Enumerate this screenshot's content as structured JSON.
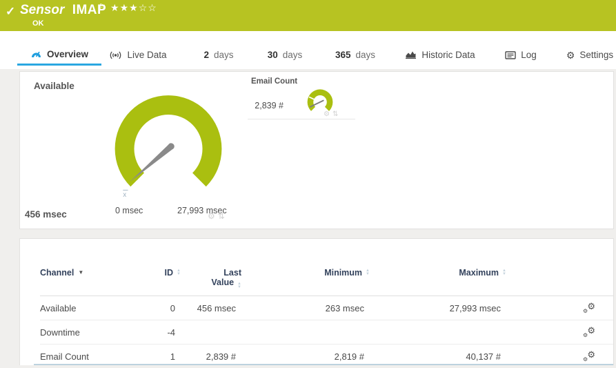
{
  "colors": {
    "header_green": "#b7c322",
    "gauge_green": "#aabf10",
    "active_tab_blue": "#2aa7e1",
    "table_header_navy": "#33425c"
  },
  "icons": {
    "check": "✓",
    "flag": "⚐",
    "star_filled": "★",
    "star_empty": "☆",
    "gear": "⚙",
    "levels": "⇅",
    "sort_up": "▲",
    "sort_down": "▼"
  },
  "header": {
    "title_prefix": "Sensor",
    "title_name": "IMAP",
    "status": "OK",
    "rating_filled": 3,
    "rating_total": 5
  },
  "tabs": [
    {
      "id": "overview",
      "label": "Overview",
      "icon": "gauge-icon",
      "active": true
    },
    {
      "id": "live-data",
      "label": "Live Data",
      "icon": "broadcast-icon",
      "active": false
    },
    {
      "id": "2-days",
      "num": "2",
      "label": "days",
      "active": false
    },
    {
      "id": "30-days",
      "num": "30",
      "label": "days",
      "active": false
    },
    {
      "id": "365-days",
      "num": "365",
      "label": "days",
      "active": false
    },
    {
      "id": "historic-data",
      "label": "Historic Data",
      "icon": "historic-icon",
      "active": false
    },
    {
      "id": "log",
      "label": "Log",
      "icon": "log-icon",
      "active": false
    },
    {
      "id": "settings",
      "label": "Settings",
      "icon": "settings-icon",
      "active": false
    }
  ],
  "gauge_panel": {
    "available": {
      "label": "Available",
      "value": 456,
      "scale_min": 0,
      "scale_max": 27993,
      "value_label": "456 msec",
      "scale_min_label": "0 msec",
      "scale_max_label": "27,993 msec",
      "avg_marker_label": "x"
    },
    "email_count": {
      "label": "Email Count",
      "value": 2839,
      "scale_min": 0,
      "scale_max": 40137,
      "value_label": "2,839 #"
    }
  },
  "channel_table": {
    "columns": [
      {
        "label": "Channel",
        "sort": "desc",
        "align": "left"
      },
      {
        "label": "ID",
        "sort": "both",
        "align": "right"
      },
      {
        "label": "Last Value",
        "lines": [
          "Last",
          "Value"
        ],
        "sort": "both",
        "align": "right"
      },
      {
        "label": "Minimum",
        "sort": "both",
        "align": "right"
      },
      {
        "label": "Maximum",
        "sort": "both",
        "align": "right"
      }
    ],
    "rows": [
      {
        "channel": "Available",
        "id": "0",
        "last_value": "456 msec",
        "minimum": "263 msec",
        "maximum": "27,993 msec"
      },
      {
        "channel": "Downtime",
        "id": "-4",
        "last_value": "",
        "minimum": "",
        "maximum": ""
      },
      {
        "channel": "Email Count",
        "id": "1",
        "last_value": "2,839 #",
        "minimum": "2,819 #",
        "maximum": "40,137 #"
      }
    ]
  }
}
